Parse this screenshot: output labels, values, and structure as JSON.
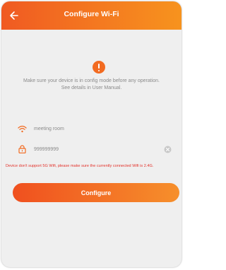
{
  "header": {
    "title": "Configure Wi-Fi",
    "back_icon": "arrow-left-icon"
  },
  "notice": {
    "icon": "exclamation-circle-icon",
    "line1": "Make sure your device is in config mode before any operation.",
    "line2": "See details in User Manual."
  },
  "wifi": {
    "icon": "wifi-icon",
    "ssid": "meeting room"
  },
  "password": {
    "icon": "lock-icon",
    "value": "999999999",
    "clear_icon": "clear-circle-icon"
  },
  "warning": {
    "text": "Device don't support 5G Wifi, please make sure the currently connected Wifi is 2.4G."
  },
  "configure_button": {
    "label": "Configure"
  },
  "colors": {
    "accent_start": "#f05a22",
    "accent_end": "#f7931e",
    "warning": "#e3322b",
    "background": "#efefef"
  }
}
